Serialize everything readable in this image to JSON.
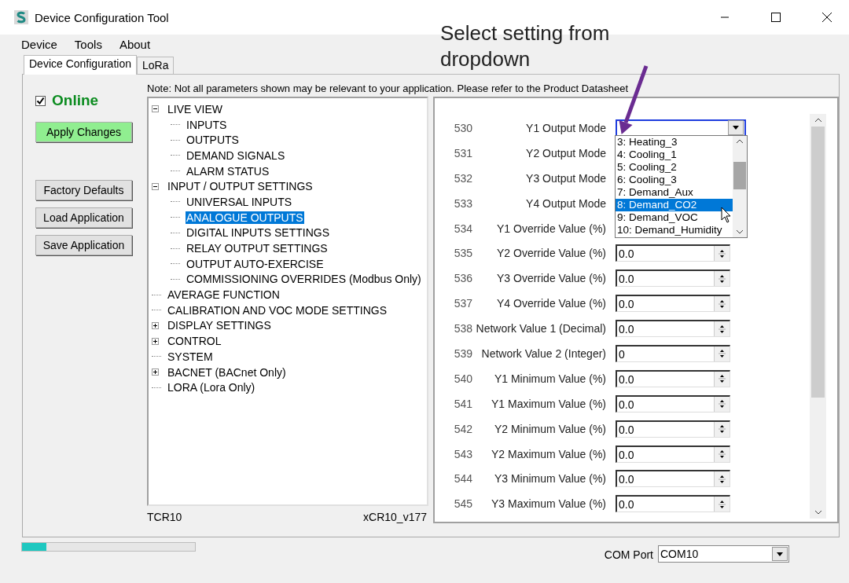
{
  "window": {
    "title": "Device Configuration Tool"
  },
  "menu": [
    "Device",
    "Tools",
    "About"
  ],
  "tabs": [
    {
      "label": "Device Configuration",
      "selected": true
    },
    {
      "label": "LoRa",
      "selected": false
    }
  ],
  "online": {
    "label": "Online",
    "checked": true
  },
  "buttons": [
    {
      "label": "Apply Changes",
      "kind": "apply"
    },
    {
      "label": "Factory Defaults",
      "kind": "plain"
    },
    {
      "label": "Load Application",
      "kind": "plain"
    },
    {
      "label": "Save Application",
      "kind": "plain"
    }
  ],
  "note": "Note: Not all parameters shown may be relevant to your application. Please refer to the Product Datasheet",
  "tree": [
    {
      "label": "LIVE VIEW",
      "expanded": true,
      "selected": false,
      "children": [
        {
          "label": "INPUTS",
          "selected": false
        },
        {
          "label": "OUTPUTS",
          "selected": false
        },
        {
          "label": "DEMAND SIGNALS",
          "selected": false
        },
        {
          "label": "ALARM STATUS",
          "selected": false
        }
      ]
    },
    {
      "label": "INPUT / OUTPUT SETTINGS",
      "expanded": true,
      "selected": false,
      "children": [
        {
          "label": "UNIVERSAL INPUTS",
          "selected": false
        },
        {
          "label": "ANALOGUE OUTPUTS",
          "selected": true
        },
        {
          "label": "DIGITAL INPUTS SETTINGS",
          "selected": false
        },
        {
          "label": "RELAY OUTPUT SETTINGS",
          "selected": false
        },
        {
          "label": "OUTPUT AUTO-EXERCISE",
          "selected": false
        },
        {
          "label": "COMMISSIONING OVERRIDES (Modbus Only)",
          "selected": false
        }
      ]
    },
    {
      "label": "AVERAGE FUNCTION",
      "selected": false
    },
    {
      "label": "CALIBRATION AND VOC MODE SETTINGS",
      "selected": false
    },
    {
      "label": "DISPLAY SETTINGS",
      "expanded": false,
      "selected": false
    },
    {
      "label": "CONTROL",
      "expanded": false,
      "selected": false
    },
    {
      "label": "SYSTEM",
      "selected": false
    },
    {
      "label": "BACNET (BACnet Only)",
      "expanded": false,
      "selected": false
    },
    {
      "label": "LORA (Lora Only)",
      "selected": false
    }
  ],
  "device_model": "TCR10",
  "firmware": "xCR10_v177",
  "parameters": [
    {
      "number": "530",
      "label": "Y1 Output Mode",
      "kind": "combo",
      "focused": true,
      "dropdown_options": [
        {
          "label": "3:  Heating_3",
          "selected": false
        },
        {
          "label": "4:  Cooling_1",
          "selected": false
        },
        {
          "label": "5:  Cooling_2",
          "selected": false
        },
        {
          "label": "6:  Cooling_3",
          "selected": false
        },
        {
          "label": "7:  Demand_Aux",
          "selected": false
        },
        {
          "label": "8:  Demand_CO2",
          "selected": true
        },
        {
          "label": "9:  Demand_VOC",
          "selected": false
        },
        {
          "label": "10:  Demand_Humidity",
          "selected": false
        }
      ]
    },
    {
      "number": "531",
      "label": "Y2 Output Mode"
    },
    {
      "number": "532",
      "label": "Y3 Output Mode"
    },
    {
      "number": "533",
      "label": "Y4 Output Mode"
    },
    {
      "number": "534",
      "label": "Y1 Override Value (%)"
    },
    {
      "number": "535",
      "label": "Y2 Override Value (%)",
      "kind": "spin",
      "value": "0.0"
    },
    {
      "number": "536",
      "label": "Y3 Override Value (%)",
      "kind": "spin",
      "value": "0.0"
    },
    {
      "number": "537",
      "label": "Y4 Override Value (%)",
      "kind": "spin",
      "value": "0.0"
    },
    {
      "number": "538",
      "label": "Network Value 1 (Decimal)",
      "kind": "spin",
      "value": "0.0"
    },
    {
      "number": "539",
      "label": "Network Value 2 (Integer)",
      "kind": "spin",
      "value": "0"
    },
    {
      "number": "540",
      "label": "Y1 Minimum Value (%)",
      "kind": "spin",
      "value": "0.0"
    },
    {
      "number": "541",
      "label": "Y1 Maximum Value (%)",
      "kind": "spin",
      "value": "0.0"
    },
    {
      "number": "542",
      "label": "Y2 Minimum Value (%)",
      "kind": "spin",
      "value": "0.0"
    },
    {
      "number": "543",
      "label": "Y2 Maximum Value (%)",
      "kind": "spin",
      "value": "0.0"
    },
    {
      "number": "544",
      "label": "Y3 Minimum Value (%)",
      "kind": "spin",
      "value": "0.0"
    },
    {
      "number": "545",
      "label": "Y3 Maximum Value (%)",
      "kind": "spin",
      "value": "0.0"
    }
  ],
  "progress": {
    "level": 0.14
  },
  "com_port": {
    "label": "COM Port",
    "value": "COM10"
  },
  "callout": {
    "text": "Select setting from dropdown"
  }
}
